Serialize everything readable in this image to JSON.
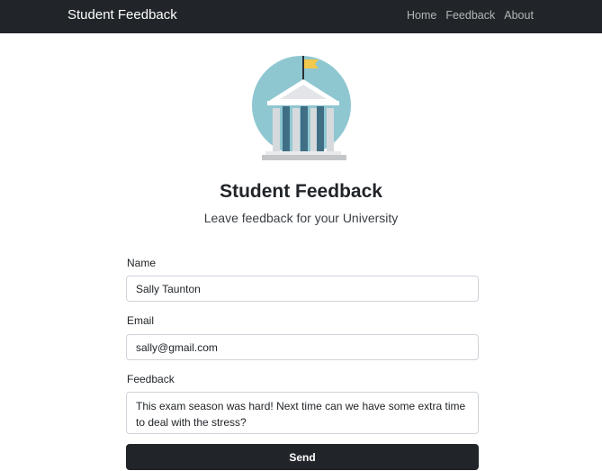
{
  "navbar": {
    "brand": "Student Feedback",
    "links": [
      "Home",
      "Feedback",
      "About"
    ]
  },
  "header": {
    "logo_icon": "university-building-icon",
    "title": "Student Feedback",
    "subtitle": "Leave feedback for your University"
  },
  "form": {
    "name_label": "Name",
    "name_value": "Sally Taunton",
    "email_label": "Email",
    "email_value": "sally@gmail.com",
    "feedback_label": "Feedback",
    "feedback_value": "This exam season was hard! Next time can we have some extra time to deal with the stress?",
    "send_label": "Send"
  },
  "colors": {
    "navbar": "#212529",
    "logo_circle": "#8fc7d1",
    "flag": "#f2c94c",
    "columns": "#3f6e85",
    "button": "#212529"
  }
}
